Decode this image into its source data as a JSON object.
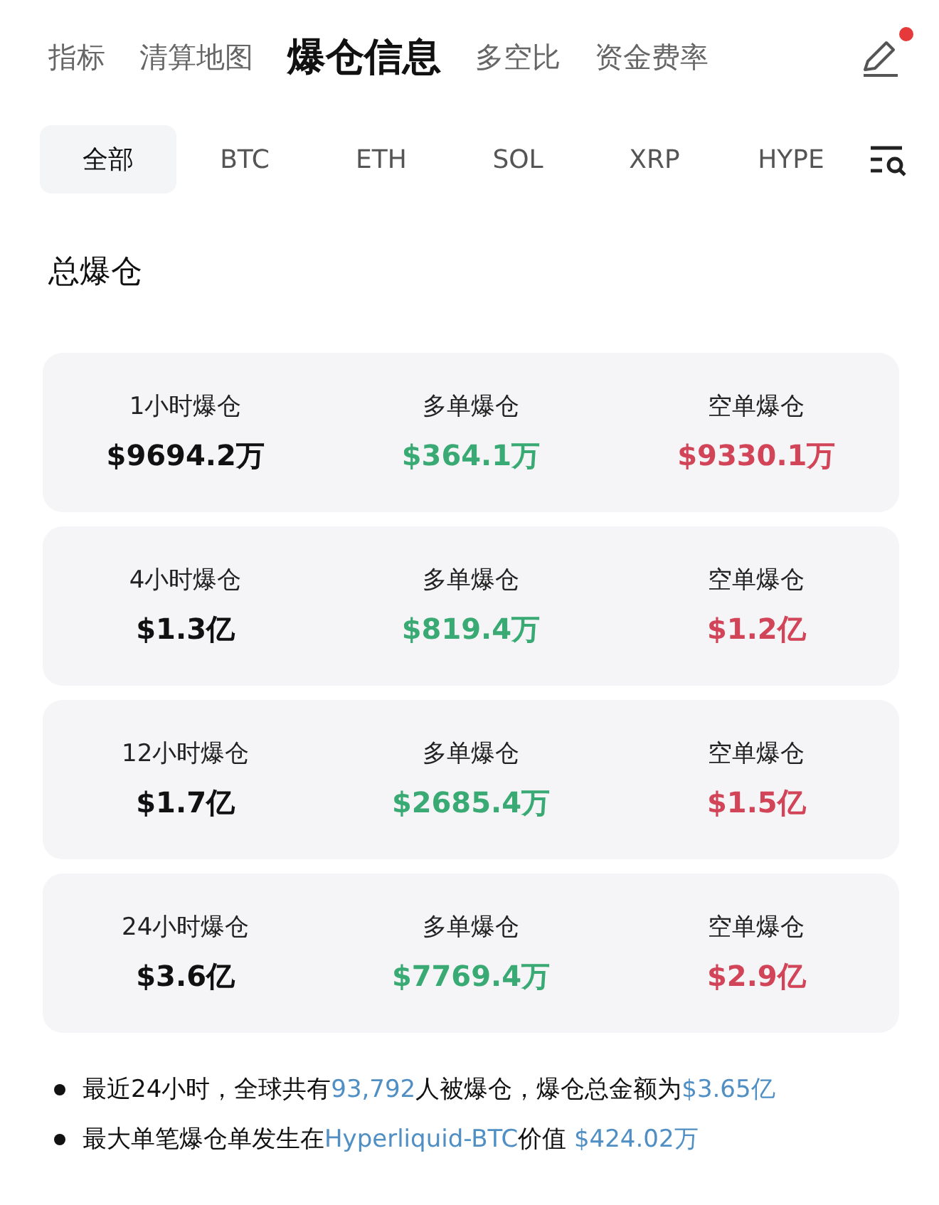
{
  "nav_tabs": [
    {
      "label": "指标",
      "selected": false
    },
    {
      "label": "清算地图",
      "selected": false
    },
    {
      "label": "爆仓信息",
      "selected": true
    },
    {
      "label": "多空比",
      "selected": false
    },
    {
      "label": "资金费率",
      "selected": false
    }
  ],
  "edit_badge": true,
  "coin_filters": [
    {
      "label": "全部",
      "selected": true
    },
    {
      "label": "BTC",
      "selected": false
    },
    {
      "label": "ETH",
      "selected": false
    },
    {
      "label": "SOL",
      "selected": false
    },
    {
      "label": "XRP",
      "selected": false
    },
    {
      "label": "HYPE",
      "selected": false
    }
  ],
  "section_title": "总爆仓",
  "cards": [
    {
      "cells": [
        {
          "label": "1小时爆仓",
          "value": "$9694.2万",
          "kind": "total"
        },
        {
          "label": "多单爆仓",
          "value": "$364.1万",
          "kind": "long"
        },
        {
          "label": "空单爆仓",
          "value": "$9330.1万",
          "kind": "short"
        }
      ]
    },
    {
      "cells": [
        {
          "label": "4小时爆仓",
          "value": "$1.3亿",
          "kind": "total"
        },
        {
          "label": "多单爆仓",
          "value": "$819.4万",
          "kind": "long"
        },
        {
          "label": "空单爆仓",
          "value": "$1.2亿",
          "kind": "short"
        }
      ]
    },
    {
      "cells": [
        {
          "label": "12小时爆仓",
          "value": "$1.7亿",
          "kind": "total"
        },
        {
          "label": "多单爆仓",
          "value": "$2685.4万",
          "kind": "long"
        },
        {
          "label": "空单爆仓",
          "value": "$1.5亿",
          "kind": "short"
        }
      ]
    },
    {
      "cells": [
        {
          "label": "24小时爆仓",
          "value": "$3.6亿",
          "kind": "total"
        },
        {
          "label": "多单爆仓",
          "value": "$7769.4万",
          "kind": "long"
        },
        {
          "label": "空单爆仓",
          "value": "$2.9亿",
          "kind": "short"
        }
      ]
    }
  ],
  "notes": [
    {
      "segments": [
        {
          "text": "最近24小时，全球共有",
          "highlight": false
        },
        {
          "text": "93,792",
          "highlight": true
        },
        {
          "text": "人被爆仓，爆仓总金额为",
          "highlight": false
        },
        {
          "text": "$3.65亿",
          "highlight": true
        }
      ]
    },
    {
      "segments": [
        {
          "text": "最大单笔爆仓单发生在",
          "highlight": false
        },
        {
          "text": "Hyperliquid-BTC",
          "highlight": true
        },
        {
          "text": "价值 ",
          "highlight": false
        },
        {
          "text": "$424.02万",
          "highlight": true
        }
      ]
    }
  ]
}
